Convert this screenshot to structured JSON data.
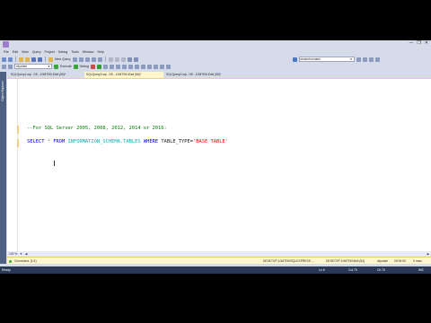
{
  "title_bar": {
    "controls": [
      "—",
      "❐",
      "✕"
    ]
  },
  "menu": [
    "File",
    "Edit",
    "View",
    "Query",
    "Project",
    "Debug",
    "Tools",
    "Window",
    "Help"
  ],
  "toolbar": {
    "new_query_label": "New Query",
    "database_value": "cityduke",
    "execute_label": "Execute",
    "debug_label": "Debug",
    "search_value": "tessiertromaine"
  },
  "side_panel": {
    "label": "Object Explorer"
  },
  "tabs": [
    {
      "label": "SQLQuery1.sql - DE...10MTI90.iDell (55)*"
    },
    {
      "label": "SQLQuery3.sql - DE...10MTI90.iDell (56)*"
    },
    {
      "label": "SQLQuery2.sql - DE...10MTI90.iDell (55)*"
    }
  ],
  "editor": {
    "comment": "--For SQL Server 2005, 2008, 2012, 2014 or 2016:",
    "query": {
      "kw_select": "SELECT",
      "star": " * ",
      "kw_from": "FROM",
      "table": " INFORMATION_SCHEMA.TABLES ",
      "kw_where": "WHERE",
      "column": " TABLE_TYPE=",
      "string": "'BASE TABLE'"
    }
  },
  "zoom": {
    "value": "100 %"
  },
  "query_status": {
    "connected": "Connected. (1/1)",
    "server": "DESKTOP-10MTI90\\SQLEXPRESS ...",
    "login": "DESKTOP-10MTI90\\Dell (54)",
    "database": "cityduke",
    "elapsed": "00:00:00",
    "rows": "0 rows"
  },
  "status_bar": {
    "ready": "Ready",
    "line": "Ln 6",
    "col": "Col 70",
    "ch": "Ch 70",
    "mode": "INS"
  },
  "colors": {
    "window_chrome": "#d6dbe9",
    "status_bar": "#293955",
    "active_tab": "#fff6cd",
    "keyword": "#0000ff",
    "comment": "#008000",
    "string": "#ff0000"
  }
}
